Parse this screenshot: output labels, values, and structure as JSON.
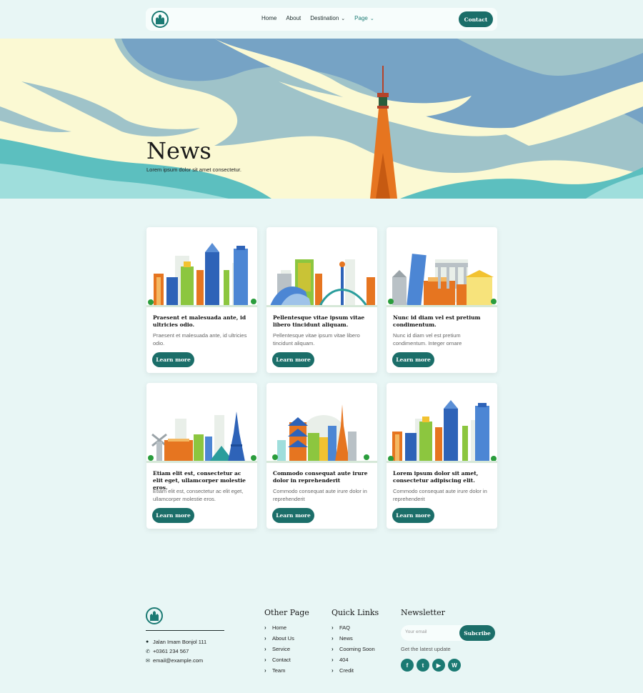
{
  "nav": {
    "items": [
      {
        "label": "Home"
      },
      {
        "label": "About"
      },
      {
        "label": "Destination"
      },
      {
        "label": "Page"
      }
    ],
    "contact_label": "Contact"
  },
  "hero": {
    "title": "News",
    "subtitle": "Lorem ipsum dolor sit amet consectetur."
  },
  "cards": [
    {
      "title": "Praesent et malesuada ante, id ultricies odio.",
      "text": "Praesent et malesuada ante, id ultricies odio.",
      "button": "Learn more"
    },
    {
      "title": "Pellentesque vitae ipsum vitae libero tincidunt aliquam.",
      "text": "Pellentesque vitae ipsum vitae libero tincidunt aliquam.",
      "button": "Learn more"
    },
    {
      "title": "Nunc id diam vel est pretium condimentum.",
      "text": "Nunc id diam vel est pretium condimentum. Integer ornare",
      "button": "Learn more"
    },
    {
      "title": "Etiam elit est, consectetur ac elit eget, ullamcorper molestie eros.",
      "text": "Etiam elit est, consectetur ac elit eget, ullamcorper molestie eros.",
      "button": "Learn more"
    },
    {
      "title": "Commodo consequat aute irure dolor in reprehenderit",
      "text": "Commodo consequat aute irure dolor in reprehenderit",
      "button": "Learn more"
    },
    {
      "title": "Lorem ipsum dolor sit amet, consectetur adipiscing elit.",
      "text": "Commodo consequat aute irure dolor in reprehenderit",
      "button": "Learn more"
    }
  ],
  "footer": {
    "address": "Jalan Imam Bonjol 111",
    "phone": "+0361 234 567",
    "email": "email@example.com",
    "other_page": {
      "heading": "Other Page",
      "links": [
        "Home",
        "About Us",
        "Service",
        "Contact",
        "Team"
      ]
    },
    "quick_links": {
      "heading": "Quick Links",
      "links": [
        "FAQ",
        "News",
        "Cooming Soon",
        "404",
        "Credit"
      ]
    },
    "newsletter": {
      "heading": "Newsletter",
      "placeholder": "Your email",
      "button": "Subcribe",
      "note": "Get the latest update"
    }
  },
  "colors": {
    "primary": "#1b6e69",
    "background": "#e8f6f5",
    "sky": "#76a3c5",
    "cloud": "#fbf9d3",
    "tower": "#e67520"
  }
}
